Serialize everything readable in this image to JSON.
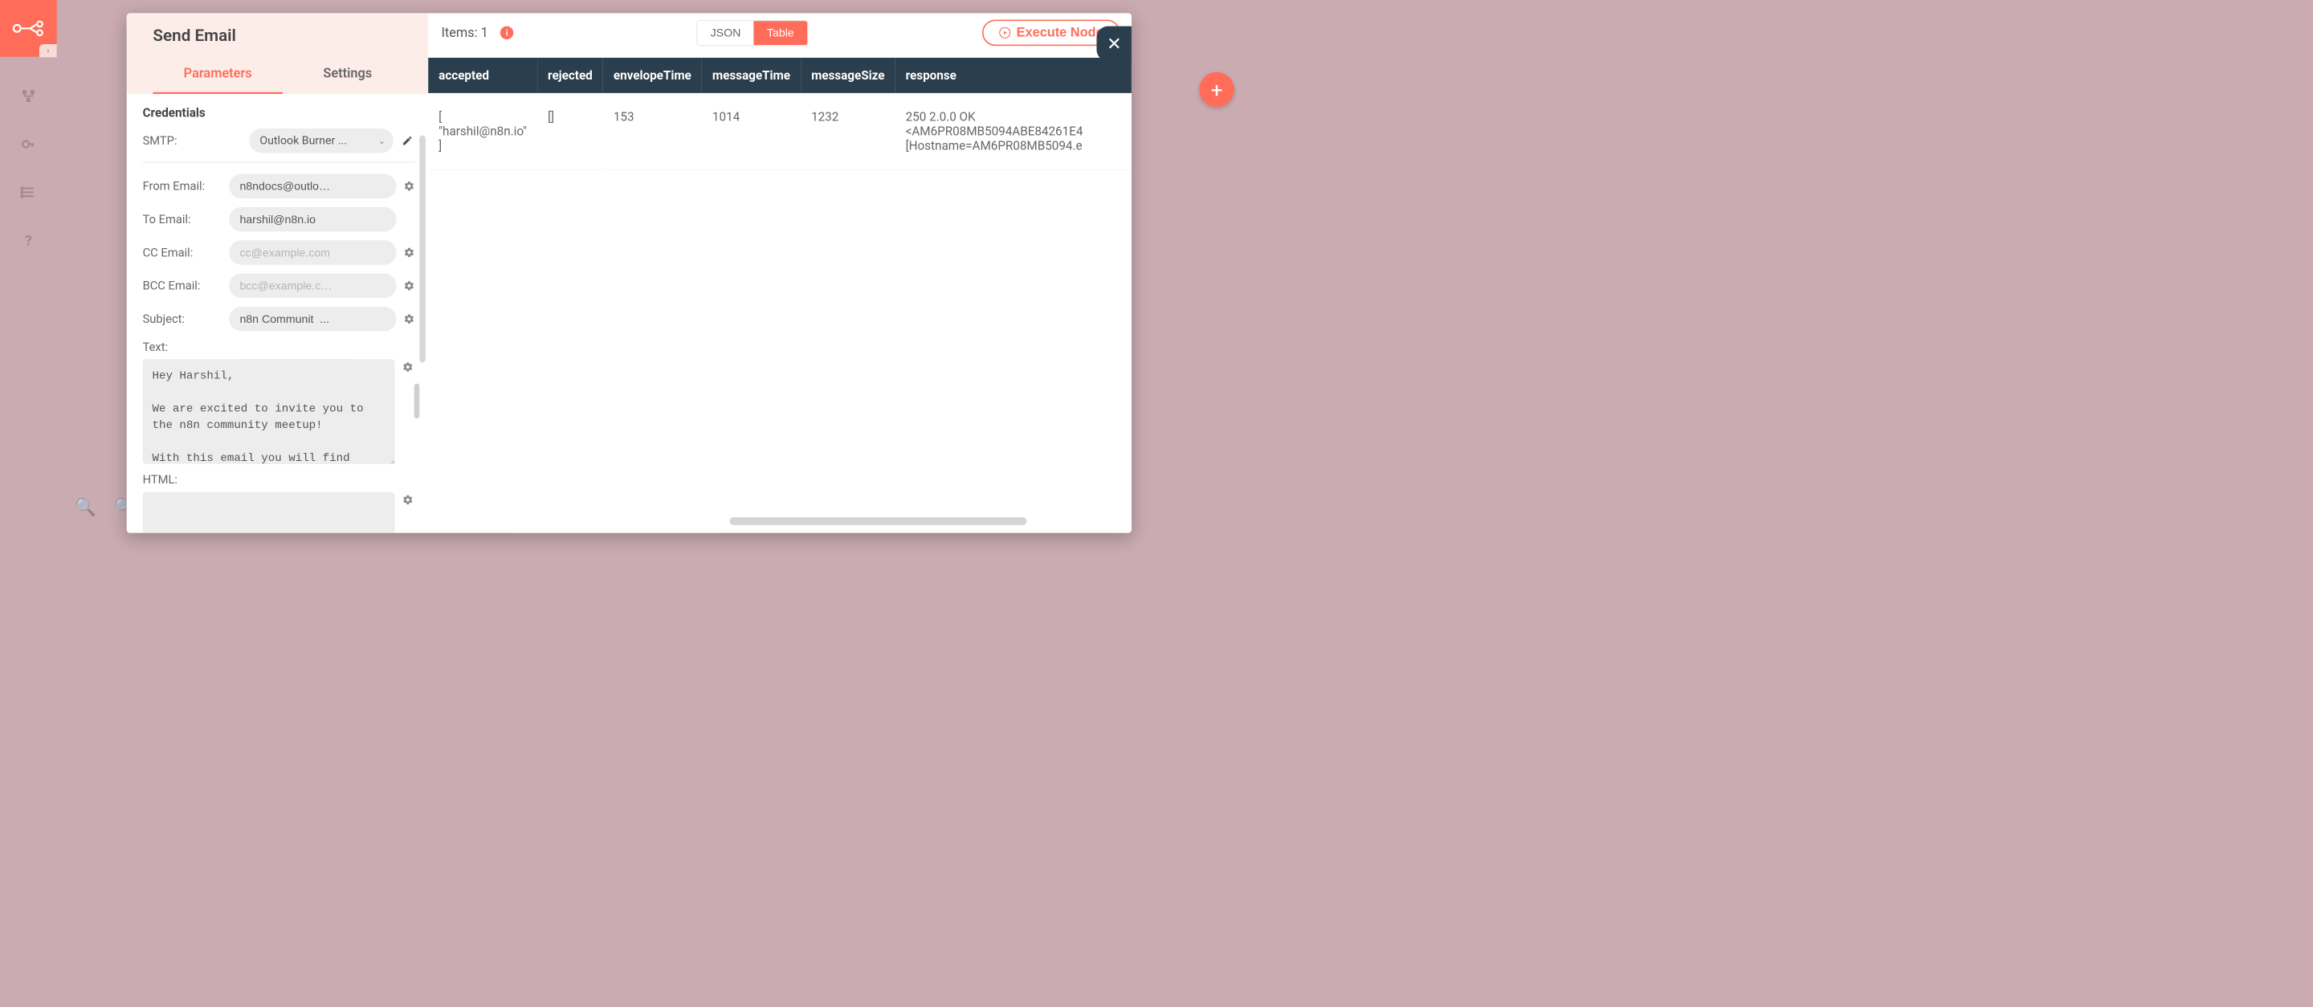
{
  "node": {
    "title": "Send Email",
    "tabs": {
      "parameters": "Parameters",
      "settings": "Settings"
    },
    "credentials_heading": "Credentials",
    "smtp_label": "SMTP:",
    "smtp_value": "Outlook Burner  ...",
    "fields": {
      "from": {
        "label": "From Email:",
        "value": "n8ndocs@outlo…"
      },
      "to": {
        "label": "To Email:",
        "value": "harshil@n8n.io"
      },
      "cc": {
        "label": "CC Email:",
        "placeholder": "cc@example.com"
      },
      "bcc": {
        "label": "BCC Email:",
        "placeholder": "bcc@example.c…"
      },
      "subject": {
        "label": "Subject:",
        "value": "n8n Communit  ..."
      },
      "text": {
        "label": "Text:",
        "value": "Hey Harshil,\n\nWe are excited to invite you to the n8n community meetup!\n\nWith this email you will find"
      },
      "html": {
        "label": "HTML:"
      }
    }
  },
  "output": {
    "items_label": "Items: 1",
    "view_toggle": {
      "json": "JSON",
      "table": "Table"
    },
    "execute_label": "Execute Node",
    "columns": [
      "accepted",
      "rejected",
      "envelopeTime",
      "messageTime",
      "messageSize",
      "response"
    ],
    "rows": [
      {
        "accepted": "[\n\"harshil@n8n.io\"\n]",
        "rejected": "[]",
        "envelopeTime": "153",
        "messageTime": "1014",
        "messageSize": "1232",
        "response": "250 2.0.0 OK <AM6PR08MB5094ABE84261E4\n[Hostname=AM6PR08MB5094.e"
      }
    ]
  }
}
